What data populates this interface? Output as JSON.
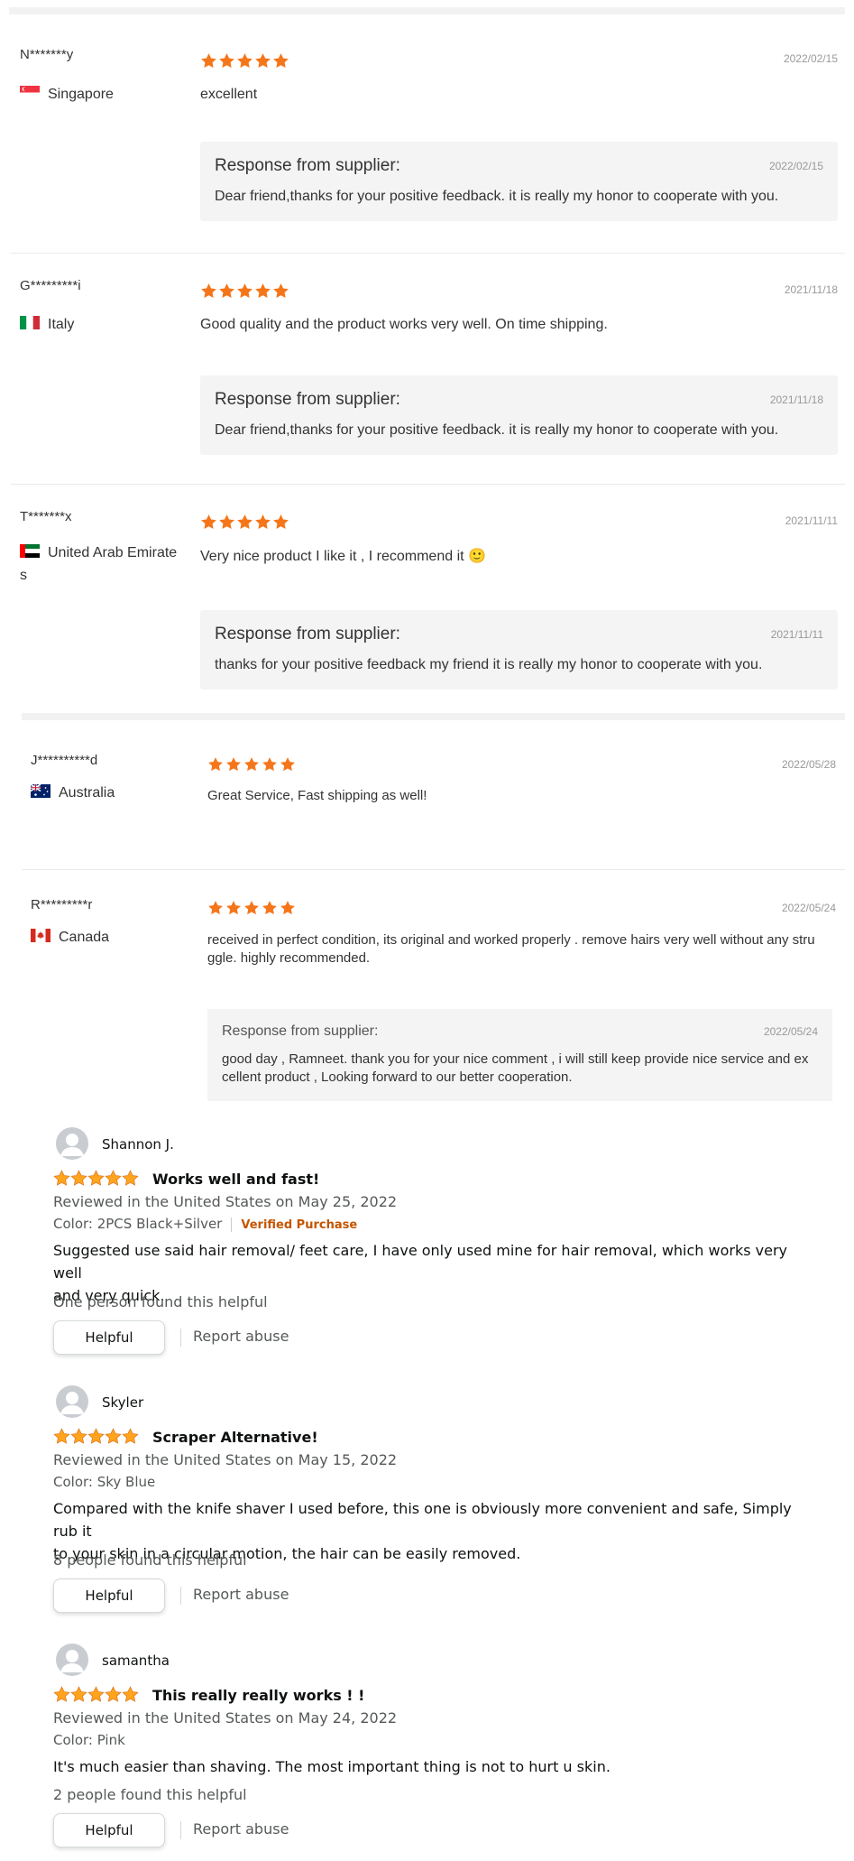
{
  "colors": {
    "star_orange": "#f5761a",
    "star_amazon": "#ffa41c",
    "verified": "#c45500"
  },
  "supplier_reviews": [
    {
      "user": "N*******y",
      "country": "Singapore",
      "flag": "singapore",
      "date": "2022/02/15",
      "content": "excellent",
      "response": {
        "title": "Response from supplier:",
        "date": "2022/02/15",
        "body": "Dear friend,thanks for your positive feedback. it is really my honor to cooperate with you."
      }
    },
    {
      "user": "G*********i",
      "country": "Italy",
      "flag": "italy",
      "date": "2021/11/18",
      "content": "Good quality and the product works very well. On time shipping.",
      "response": {
        "title": "Response from supplier:",
        "date": "2021/11/18",
        "body": "Dear friend,thanks for your positive feedback. it is really my honor to cooperate with you."
      }
    },
    {
      "user": "T*******x",
      "country": "United Arab Emirate",
      "country_wrap": "s",
      "flag": "uae",
      "date": "2021/11/11",
      "content": "Very nice product I like it , I recommend it",
      "content_emoji": "🙂",
      "response": {
        "title": "Response from supplier:",
        "date": "2021/11/11",
        "body": "thanks for your positive feedback my friend it is really my honor to cooperate with you."
      }
    }
  ],
  "store_reviews": [
    {
      "user": "J**********d",
      "country": "Australia",
      "flag": "australia",
      "date": "2022/05/28",
      "content": "Great Service, Fast shipping as well!"
    },
    {
      "user": "R*********r",
      "country": "Canada",
      "flag": "canada",
      "date": "2022/05/24",
      "content_line1": "received in perfect condition, its original and worked properly . remove hairs very well without any stru",
      "content_line2": "ggle. highly recommended.",
      "response": {
        "title": "Response from supplier:",
        "date": "2022/05/24",
        "line1": "good day , Ramneet. thank you for your nice comment , i will still keep provide nice service and ex",
        "line2": "cellent product , Looking forward to our better cooperation."
      }
    }
  ],
  "amazon_reviews": [
    {
      "user": "Shannon J.",
      "title": "Works well and fast!",
      "reviewed": "Reviewed in the United States on May 25, 2022",
      "color": "Color: 2PCS Black+Silver",
      "verified": "Verified Purchase",
      "body_line1": "Suggested use said hair removal/ feet care, I have only used mine for hair removal, which works very well",
      "body_line2": "and very quick.",
      "helpful_text": "One person found this helpful",
      "helpful_btn": "Helpful",
      "report": "Report abuse"
    },
    {
      "user": "Skyler",
      "title": "Scraper Alternative!",
      "reviewed": "Reviewed in the United States on May 15, 2022",
      "color": "Color: Sky Blue",
      "body_line1": "Compared with the knife shaver I used before, this one is obviously more convenient and safe, Simply rub it",
      "body_line2": "to your skin in a circular motion, the hair can be easily removed.",
      "helpful_text": "8 people found this helpful",
      "helpful_btn": "Helpful",
      "report": "Report abuse"
    },
    {
      "user": "samantha",
      "title": "This really really works ! !",
      "reviewed": "Reviewed in the United States on May 24, 2022",
      "color": "Color: Pink",
      "body_line1": "It's much easier than shaving. The most important thing is not to hurt u skin.",
      "helpful_text": "2 people found this helpful",
      "helpful_btn": "Helpful",
      "report": "Report abuse"
    }
  ],
  "rating": 5
}
